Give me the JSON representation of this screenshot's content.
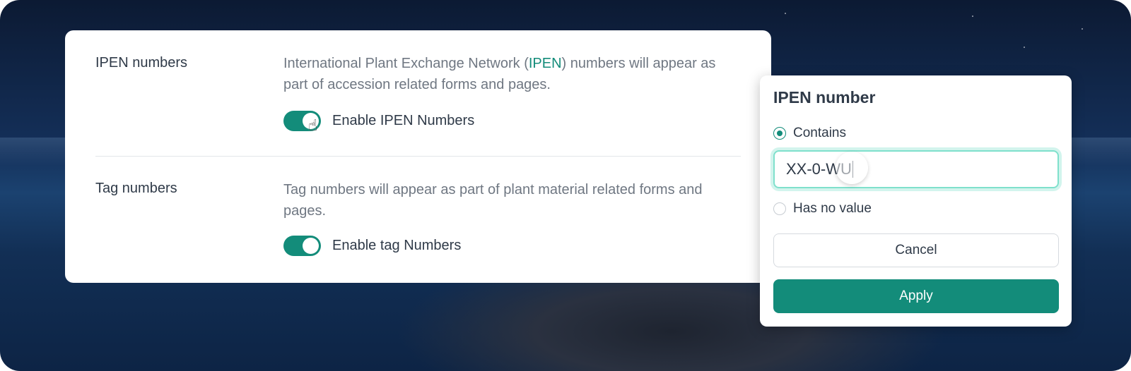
{
  "settings": {
    "ipen": {
      "title": "IPEN numbers",
      "desc_prefix": "International Plant Exchange Network (",
      "desc_link": "IPEN",
      "desc_suffix": ") numbers will appear as part of accession related forms and pages.",
      "toggle_label": "Enable IPEN Numbers",
      "enabled": true
    },
    "tag": {
      "title": "Tag numbers",
      "desc": "Tag numbers will appear as part of plant material related forms and pages.",
      "toggle_label": "Enable tag Numbers",
      "enabled": true
    }
  },
  "popover": {
    "title": "IPEN number",
    "options": [
      {
        "label": "Contains",
        "selected": true
      },
      {
        "label": "Has no value",
        "selected": false
      }
    ],
    "input_value": "XX-0-WU",
    "cancel_label": "Cancel",
    "apply_label": "Apply"
  },
  "colors": {
    "accent": "#138c7a",
    "focus_ring": "#7fe0cc"
  }
}
